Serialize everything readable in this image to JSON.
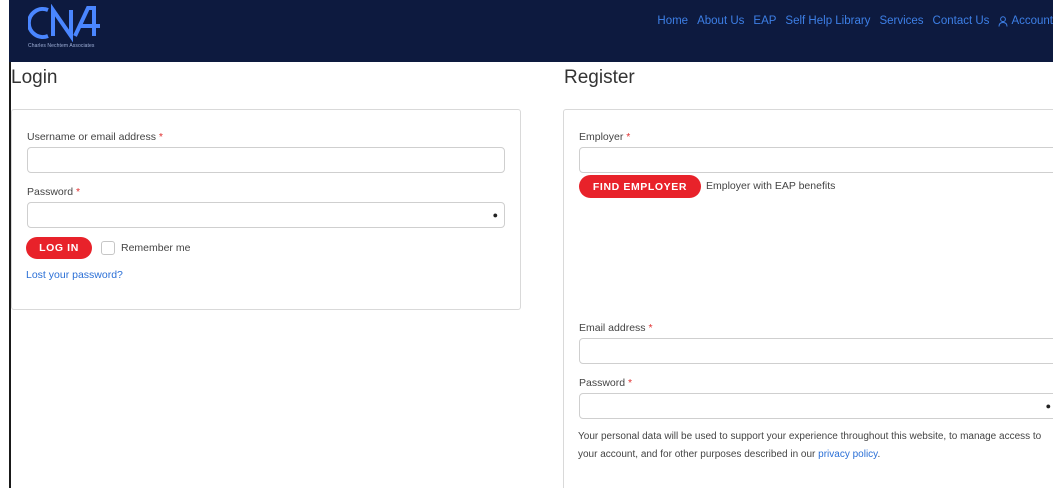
{
  "nav": {
    "logo_letters": "CNA",
    "logo_tagline": "Charles Nechtem Associates",
    "items": [
      "Home",
      "About Us",
      "EAP",
      "Self Help Library",
      "Services",
      "Contact Us"
    ],
    "account_label": "Account",
    "bg_color": "#0d1a3f",
    "link_color": "#3d7fe6"
  },
  "login": {
    "title": "Login",
    "username_label": "Username or email address",
    "password_label": "Password",
    "required_mark": "*",
    "submit_label": "LOG IN",
    "remember_label": "Remember me",
    "lost_password": "Lost your password?"
  },
  "register": {
    "title": "Register",
    "employer_label": "Employer",
    "find_employer_label": "FIND EMPLOYER",
    "employer_hint": "Employer with EAP benefits",
    "email_label": "Email address",
    "password_label": "Password",
    "required_mark": "*",
    "privacy_text": "Your personal data will be used to support your experience throughout this website, to manage access to your account, and for other purposes described in our",
    "privacy_link": "privacy policy",
    "privacy_end": "."
  },
  "icons": {
    "password_toggle": "eye-icon",
    "account": "user-icon"
  },
  "accent_color": "#e8222a"
}
